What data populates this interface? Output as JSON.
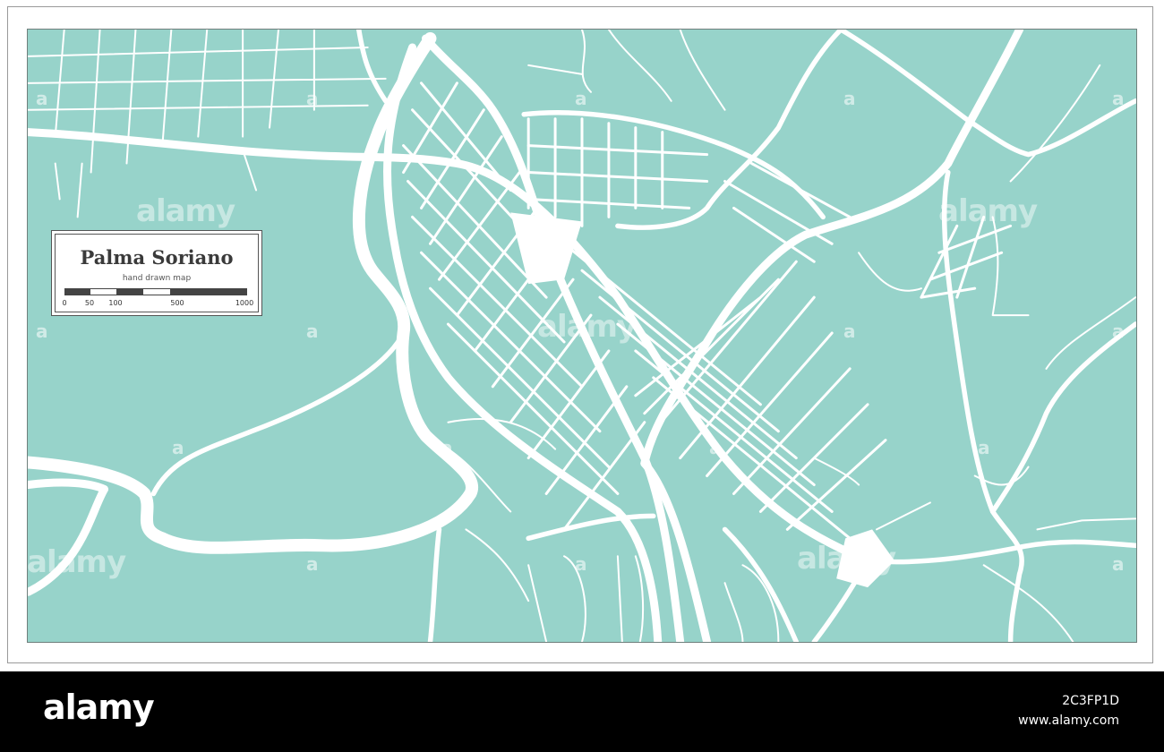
{
  "colors": {
    "water_land": "#97d3ca",
    "roads": "#ffffff",
    "text": "#3a3a3a",
    "bottom_bar": "#000000"
  },
  "legend": {
    "title": "Palma Soriano",
    "subtitle": "hand drawn map",
    "scale_ticks": [
      "0",
      "50",
      "100",
      "500",
      "1000"
    ]
  },
  "watermark": {
    "word": "alamy",
    "letter": "a"
  },
  "footer": {
    "brand": "alamy",
    "image_id": "2C3FP1D",
    "site": "www.alamy.com"
  }
}
